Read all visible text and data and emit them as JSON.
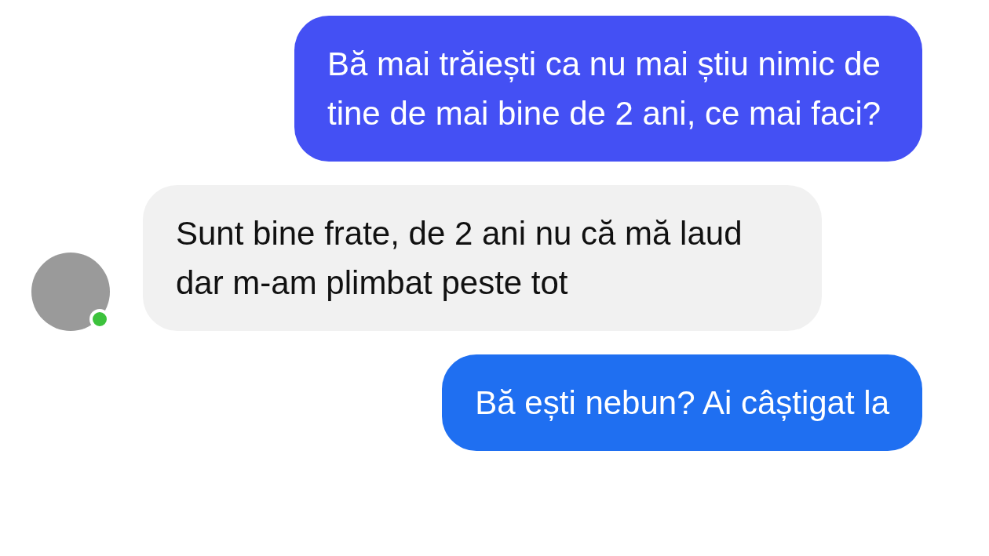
{
  "messages": [
    {
      "kind": "sent",
      "text": "Bă mai trăiești ca nu mai știu nimic de tine de mai bine de 2 ani, ce mai faci?"
    },
    {
      "kind": "received",
      "text": "Sunt bine frate, de 2 ani nu că mă laud dar m-am plimbat peste tot",
      "avatar": {
        "online": true
      }
    },
    {
      "kind": "sent",
      "text": "Bă ești nebun? Ai câștigat la"
    }
  ]
}
